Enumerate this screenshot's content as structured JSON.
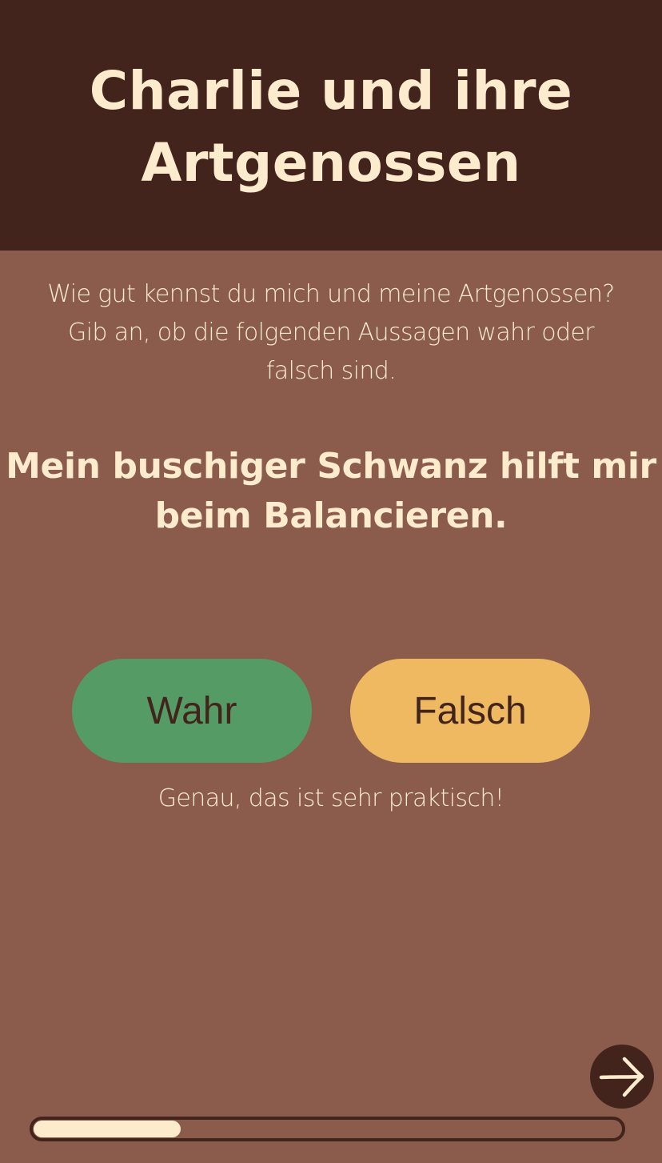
{
  "header": {
    "title": "Charlie und ihre Artgenossen"
  },
  "intro_text": "Wie gut kennst du mich und meine Artgenossen? Gib an, ob die folgenden Aussagen wahr oder falsch sind.",
  "question": "Mein buschiger Schwanz hilft mir beim Balancieren.",
  "answers": {
    "true_label": "Wahr",
    "false_label": "Falsch"
  },
  "feedback": "Genau, das ist sehr praktisch!",
  "navigation": {
    "next_icon": "arrow-right-icon"
  },
  "progress": {
    "fraction": 0.25
  },
  "colors": {
    "header_bg": "#43241d",
    "page_bg": "#8b5c4b",
    "text_cream": "#fdebcd",
    "true_button": "#559b66",
    "false_button": "#eeb960"
  }
}
